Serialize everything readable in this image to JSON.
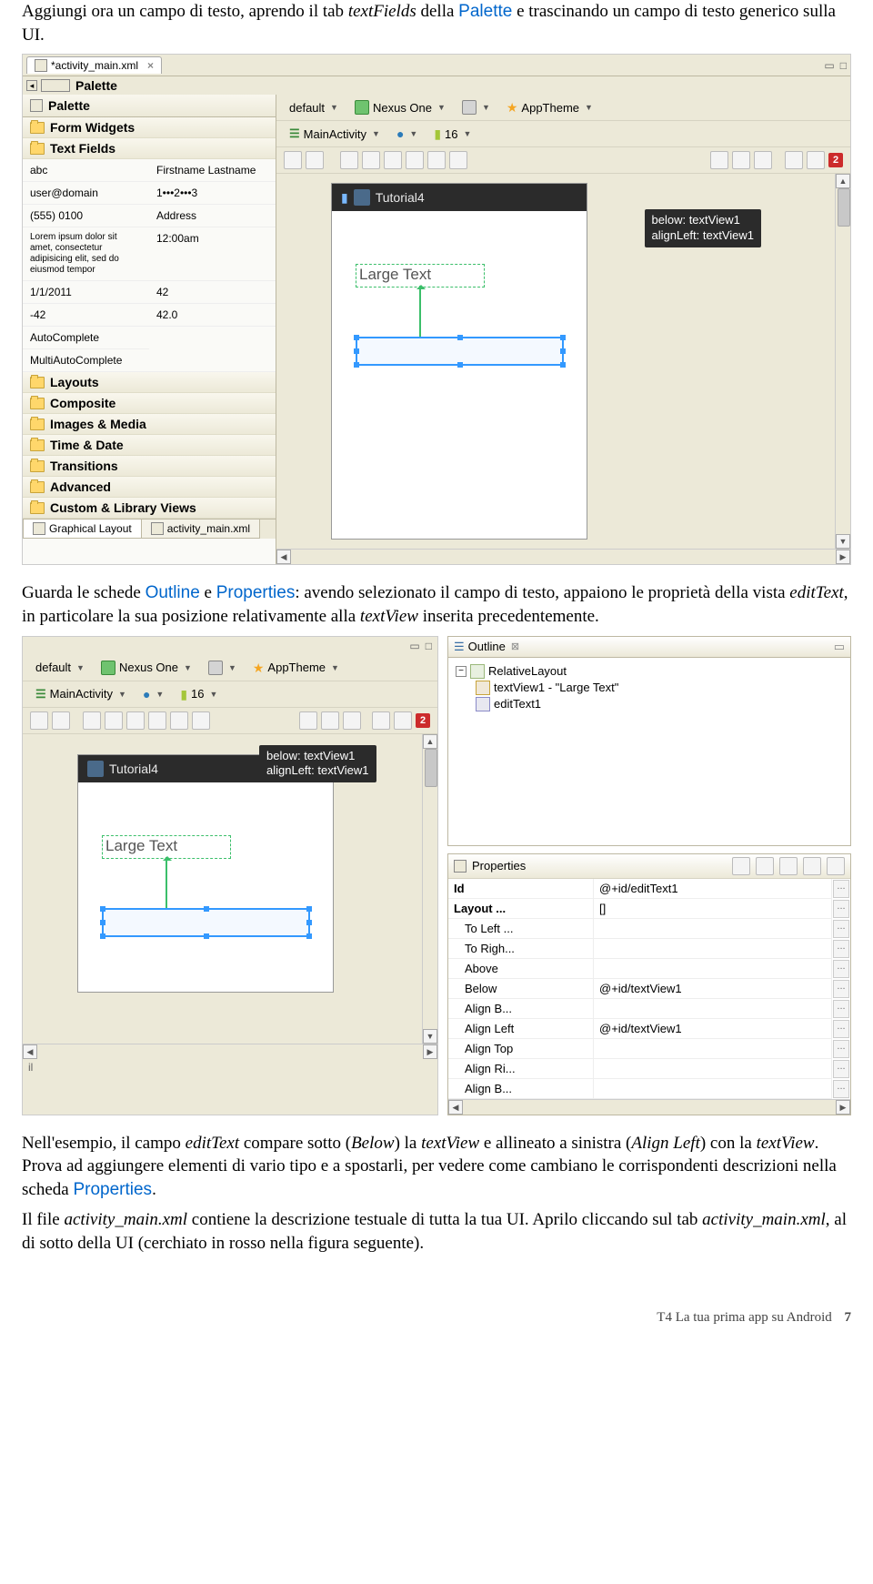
{
  "para1": {
    "pre": "Aggiungi ora un campo di testo, aprendo il tab ",
    "ital1": "textFields",
    "mid": " della ",
    "kw": "Palette",
    "post": " e trascinando un campo di testo generico sulla UI."
  },
  "ide1": {
    "tab_label": "*activity_main.xml",
    "palette_title": "Palette",
    "palette_sub": "Palette",
    "cats": [
      "Form Widgets",
      "Text Fields",
      "Layouts",
      "Composite",
      "Images & Media",
      "Time & Date",
      "Transitions",
      "Advanced",
      "Custom & Library Views"
    ],
    "tf_col1": [
      "abc",
      "user@domain",
      "Address",
      "12:00am",
      "42",
      "42.0",
      "MultiAutoComplete"
    ],
    "tf_col2": [
      "Firstname Lastname",
      "(555) 0100",
      "Lorem ipsum dolor sit amet, consectetur adipisicing elit, sed do eiusmod tempor",
      "1/1/2011",
      "-42",
      "AutoComplete"
    ],
    "tf_header": "1•••2•••3",
    "toolbar": {
      "default": "default",
      "device": "Nexus One",
      "theme": "AppTheme",
      "activity": "MainActivity",
      "api": "16"
    },
    "badge": "2",
    "phone_title": "Tutorial4",
    "large_text": "Large Text",
    "tooltip_l1": "below: textView1",
    "tooltip_l2": "alignLeft: textView1",
    "bottom_tab1": "Graphical Layout",
    "bottom_tab2": "activity_main.xml"
  },
  "para2": {
    "pre": "Guarda le schede ",
    "kw1": "Outline",
    "mid1": " e ",
    "kw2": "Properties",
    "mid2": ": avendo selezionato il campo di testo, appaiono le proprietà della vista ",
    "ital1": "editText",
    "mid3": ", in particolare la sua posizione relativamente alla ",
    "ital2": "textView",
    "post": " inserita precedentemente."
  },
  "ide2": {
    "outline_title": "Outline",
    "tree_root": "RelativeLayout",
    "tree_item1": "textView1 - \"Large Text\"",
    "tree_item2": "editText1",
    "props_title": "Properties",
    "props": [
      {
        "k": "Id",
        "v": "@+id/editText1"
      },
      {
        "k": "Layout ...",
        "v": "[]"
      },
      {
        "k": "To Left ...",
        "v": ""
      },
      {
        "k": "To Righ...",
        "v": ""
      },
      {
        "k": "Above",
        "v": ""
      },
      {
        "k": "Below",
        "v": "@+id/textView1"
      },
      {
        "k": "Align B...",
        "v": ""
      },
      {
        "k": "Align Left",
        "v": "@+id/textView1"
      },
      {
        "k": "Align Top",
        "v": ""
      },
      {
        "k": "Align Ri...",
        "v": ""
      },
      {
        "k": "Align B...",
        "v": ""
      }
    ]
  },
  "para3": {
    "pre": "Nell'esempio, il campo ",
    "ital1": "editText",
    "mid1": " compare sotto (",
    "ital2": "Below",
    "mid2": ") la ",
    "ital3": "textView",
    "mid3": " e allineato a sinistra (",
    "ital4": "Align Left",
    "mid4": ") con la ",
    "ital5": "textView",
    "mid5": ". Prova ad aggiungere elementi di vario tipo e a spostarli, per vedere come cambiano le corrispondenti descrizioni nella scheda ",
    "kw": "Properties",
    "post": "."
  },
  "para4": {
    "pre": "Il file ",
    "ital1": "activity_main.xml",
    "mid1": " contiene la descrizione testuale di tutta la tua UI. Aprilo cliccando sul tab ",
    "ital2": "activity_main.xml",
    "post": ", al di sotto della UI (cerchiato in rosso nella figura seguente)."
  },
  "footer": {
    "title": "T4  La tua prima app su Android",
    "page": "7"
  }
}
